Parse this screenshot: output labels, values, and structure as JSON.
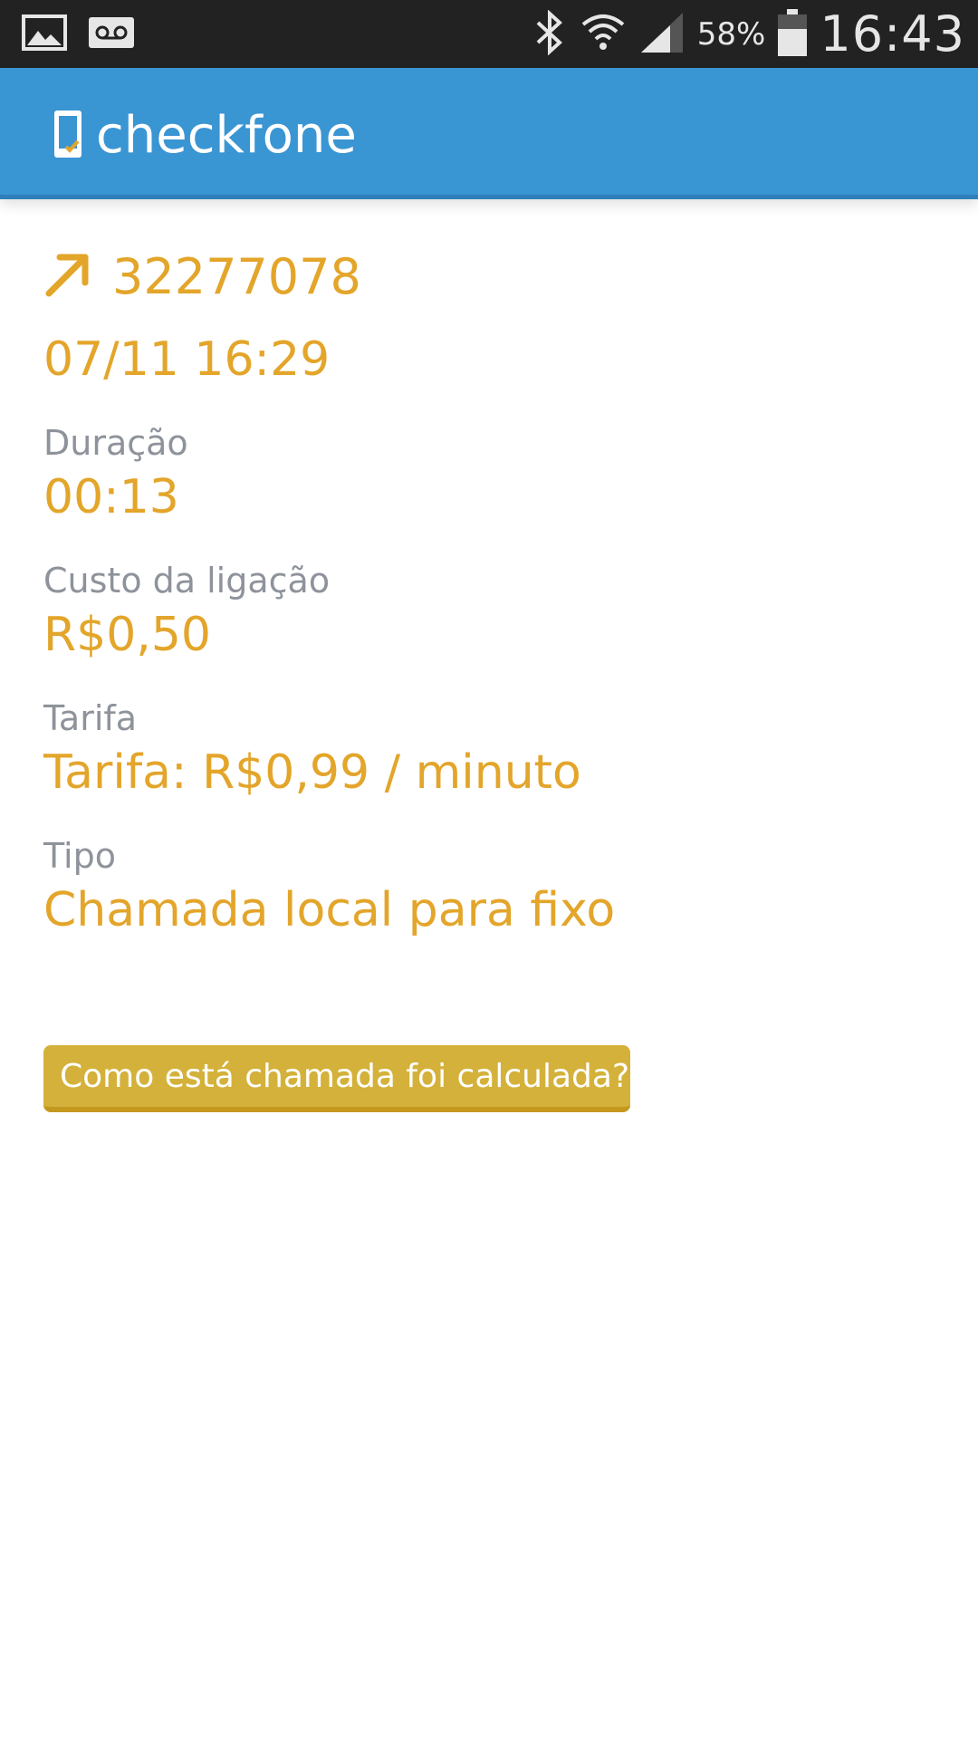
{
  "status_bar": {
    "battery_percent": "58%",
    "time": "16:43",
    "icons": [
      "gallery-icon",
      "voicemail-icon",
      "bluetooth-icon",
      "wifi-icon",
      "signal-icon",
      "battery-icon"
    ]
  },
  "app_bar": {
    "title": "checkfone",
    "color": "#3a95d3"
  },
  "call": {
    "direction_icon": "outgoing-call-arrow-icon",
    "number": "32277078",
    "datetime": "07/11 16:29",
    "fields": [
      {
        "label": "Duração",
        "value": "00:13"
      },
      {
        "label": "Custo da ligação",
        "value": "R$0,50"
      },
      {
        "label": "Tarifa",
        "value": "Tarifa: R$0,99 / minuto"
      },
      {
        "label": "Tipo",
        "value": "Chamada local para fixo"
      }
    ]
  },
  "actions": {
    "calc_button_label": "Como está chamada foi calculada?"
  },
  "colors": {
    "accent": "#e3a52a",
    "label": "#8e939b",
    "button": "#d4b13a"
  }
}
